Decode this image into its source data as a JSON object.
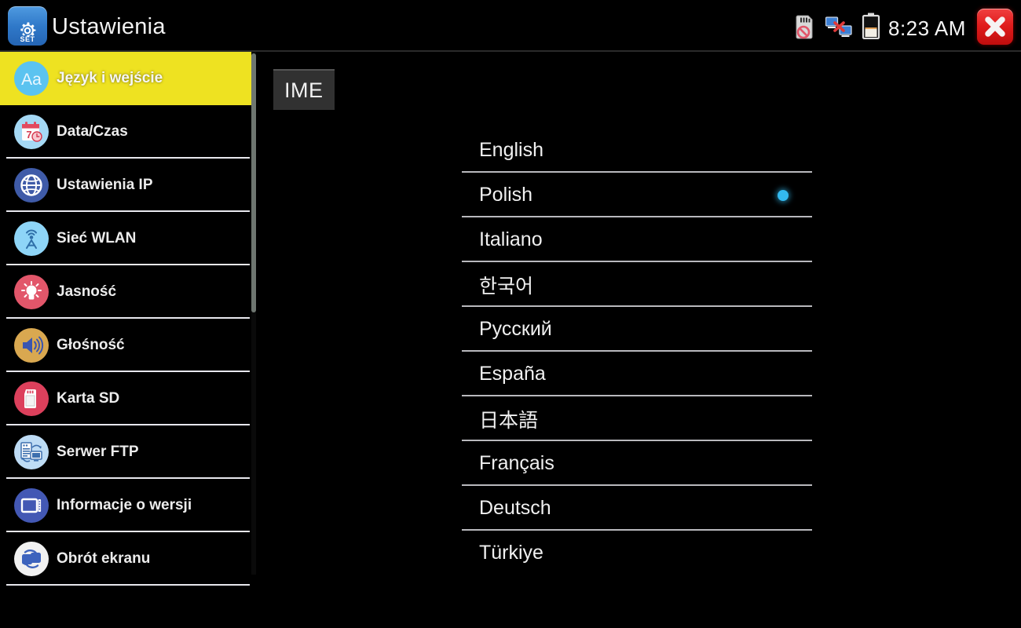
{
  "window": {
    "title": "Ustawienia",
    "app_icon": "gear-icon",
    "app_icon_label": "SET"
  },
  "statusbar": {
    "sd_icon": "sd-card-disabled-icon",
    "network_icon": "network-disconnected-icon",
    "battery_icon": "battery-icon",
    "time": "8:23 AM",
    "close_icon": "close-icon"
  },
  "sidebar": {
    "items": [
      {
        "label": "Język i wejście",
        "icon": "font-aa-icon",
        "active": true
      },
      {
        "label": "Data/Czas",
        "icon": "calendar-clock-icon",
        "active": false
      },
      {
        "label": "Ustawienia IP",
        "icon": "globe-icon",
        "active": false
      },
      {
        "label": "Sieć WLAN",
        "icon": "wifi-antenna-icon",
        "active": false
      },
      {
        "label": "Jasność",
        "icon": "brightness-bulb-icon",
        "active": false
      },
      {
        "label": "Głośność",
        "icon": "volume-speaker-icon",
        "active": false
      },
      {
        "label": "Karta SD",
        "icon": "sd-card-icon",
        "active": false
      },
      {
        "label": "Serwer FTP",
        "icon": "ftp-server-icon",
        "active": false
      },
      {
        "label": "Informacje o wersji",
        "icon": "monitor-info-icon",
        "active": false
      },
      {
        "label": "Obrót ekranu",
        "icon": "screen-rotation-icon",
        "active": false
      }
    ],
    "highlight_color": "#eee221",
    "separator_color": "#e8e8ee"
  },
  "main": {
    "tab_label": "IME",
    "languages": [
      {
        "label": "English",
        "selected": false
      },
      {
        "label": "Polish",
        "selected": true
      },
      {
        "label": "Italiano",
        "selected": false
      },
      {
        "label": "한국어",
        "selected": false
      },
      {
        "label": "Русский",
        "selected": false
      },
      {
        "label": "España",
        "selected": false
      },
      {
        "label": "日本語",
        "selected": false
      },
      {
        "label": "Français",
        "selected": false
      },
      {
        "label": "Deutsch",
        "selected": false
      },
      {
        "label": "Türkiye",
        "selected": false
      }
    ],
    "selected_language": "Polish",
    "selection_dot_color": "#33b9ef"
  }
}
